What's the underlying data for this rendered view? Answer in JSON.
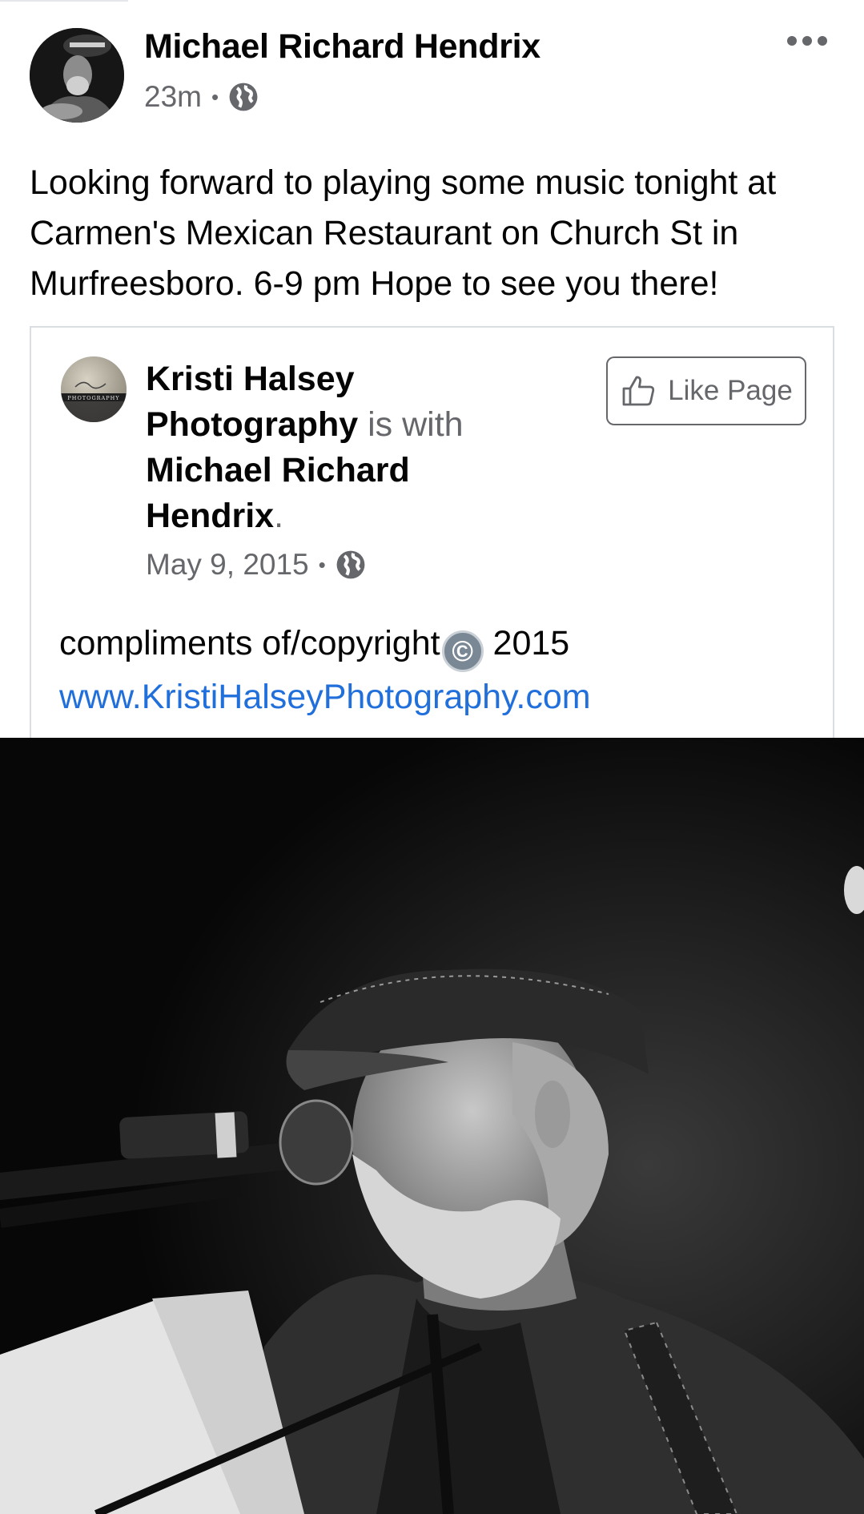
{
  "post": {
    "author": "Michael Richard Hendrix",
    "time": "23m",
    "separator": "•",
    "privacy_icon": "globe-icon",
    "text": "Looking forward to playing some music tonight at Carmen's Mexican Restaurant on Church St in Murfreesboro. 6-9 pm Hope to see you there!"
  },
  "shared": {
    "page_name": "Kristi Halsey Photography",
    "with_text": "is with",
    "tagged_name": "Michael Richard Hendrix",
    "period": ".",
    "date": "May 9, 2015",
    "separator": "•",
    "like_button": "Like Page",
    "body_text_before": "compliments of/copyright",
    "copyright_symbol": "©",
    "body_text_after": " 2015",
    "link": "www.KristiHalseyPhotography.com",
    "avatar_text": "PHOTOGRAPHY"
  },
  "colors": {
    "text": "#050505",
    "muted": "#65676b",
    "link": "#216fdb",
    "border": "#dadde1"
  }
}
